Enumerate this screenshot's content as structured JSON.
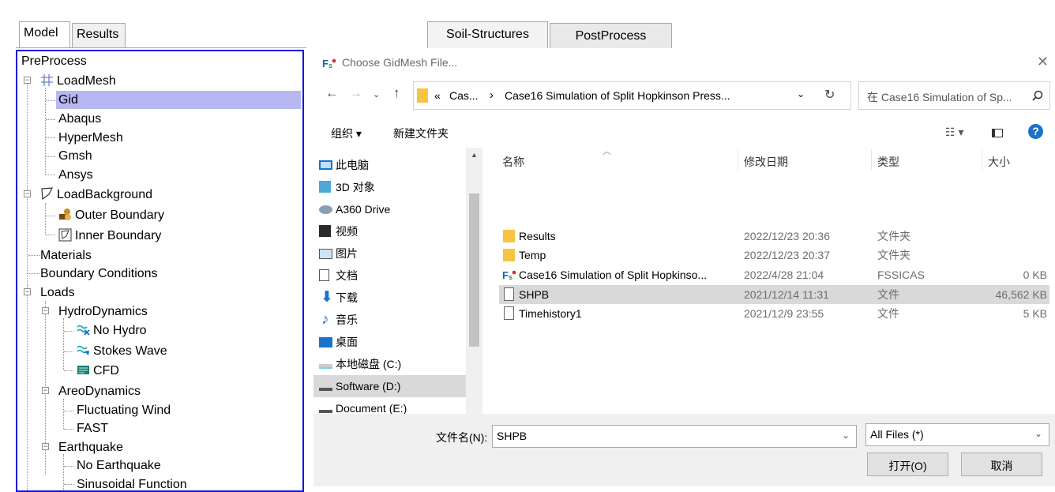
{
  "left_tabs": {
    "model": "Model",
    "results": "Results"
  },
  "tree": {
    "preprocess": "PreProcess",
    "loadmesh": "LoadMesh",
    "gid": "Gid",
    "abaqus": "Abaqus",
    "hypermesh": "HyperMesh",
    "gmsh": "Gmsh",
    "ansys": "Ansys",
    "loadbackground": "LoadBackground",
    "outer_boundary": "Outer Boundary",
    "inner_boundary": "Inner Boundary",
    "materials": "Materials",
    "boundary_conditions": "Boundary Conditions",
    "loads": "Loads",
    "hydrodynamics": "HydroDynamics",
    "no_hydro": "No Hydro",
    "stokes_wave": "Stokes Wave",
    "cfd": "CFD",
    "areodynamics": "AreoDynamics",
    "fluctuating_wind": "Fluctuating Wind",
    "fast": "FAST",
    "earthquake": "Earthquake",
    "no_earthquake": "No Earthquake",
    "sinusoidal_function": "Sinusoidal Function"
  },
  "center_tabs": {
    "soil": "Soil-Structures",
    "post": "PostProcess"
  },
  "dialog": {
    "title": "Choose GidMesh File...",
    "address_prefix": "«",
    "address_part1": "Cas...",
    "address_sep": "›",
    "address_part2": "Case16 Simulation of Split Hopkinson Press...",
    "search_placeholder": "在 Case16 Simulation of Sp...",
    "organize": "组织 ▾",
    "new_folder": "新建文件夹",
    "nav": [
      "此电脑",
      "3D 对象",
      "A360 Drive",
      "视频",
      "图片",
      "文档",
      "下载",
      "音乐",
      "桌面",
      "本地磁盘 (C:)",
      "Software (D:)",
      "Document (E:)"
    ],
    "columns": {
      "name": "名称",
      "date": "修改日期",
      "type": "类型",
      "size": "大小"
    },
    "files": [
      {
        "name": "Results",
        "date": "2022/12/23 20:36",
        "type": "文件夹",
        "size": ""
      },
      {
        "name": "Temp",
        "date": "2022/12/23 20:37",
        "type": "文件夹",
        "size": ""
      },
      {
        "name": "Case16 Simulation of Split Hopkinso...",
        "date": "2022/4/28 21:04",
        "type": "FSSICAS",
        "size": "0 KB"
      },
      {
        "name": "SHPB",
        "date": "2021/12/14 11:31",
        "type": "文件",
        "size": "46,562 KB"
      },
      {
        "name": "Timehistory1",
        "date": "2021/12/9 23:55",
        "type": "文件",
        "size": "5 KB"
      }
    ],
    "filename_label": "文件名(N):",
    "filename_value": "SHPB",
    "filter_value": "All Files (*)",
    "open_button": "打开(O)",
    "cancel_button": "取消"
  },
  "colors": {
    "panel_border": "#1515e0",
    "selection": "#b7b7f1",
    "folder": "#f6c343"
  }
}
